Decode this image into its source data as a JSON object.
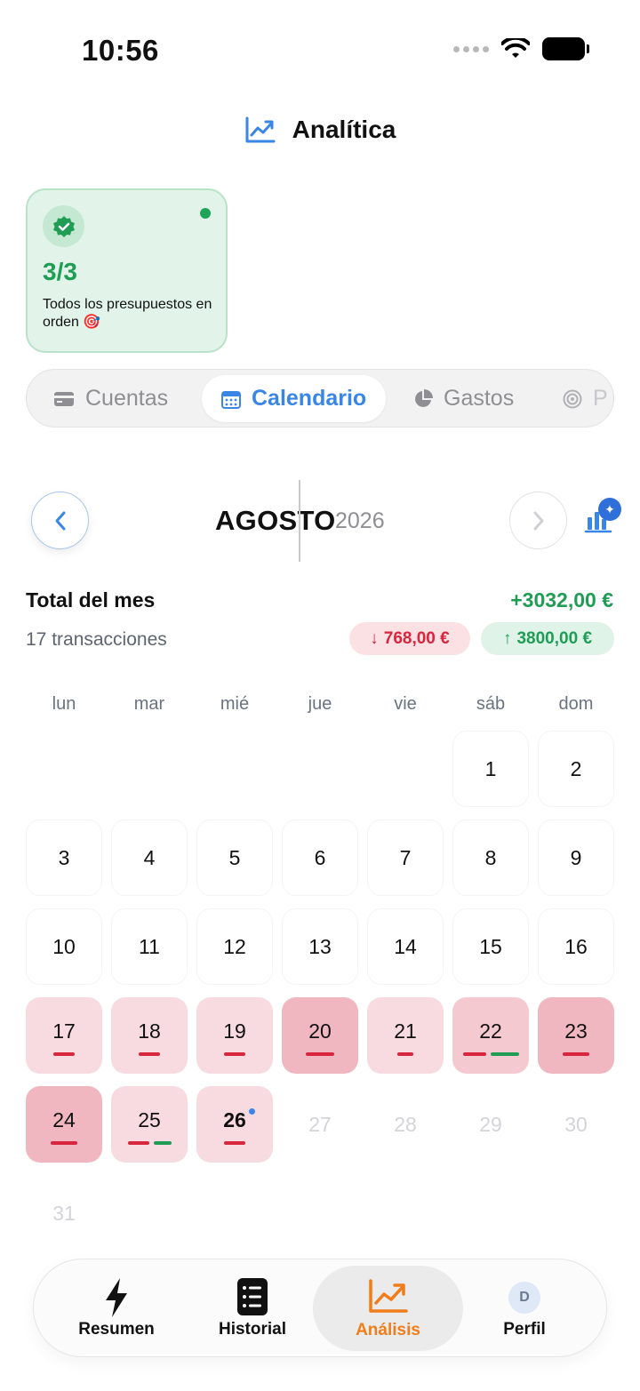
{
  "status": {
    "time": "10:56"
  },
  "header": {
    "title": "Analítica",
    "icon": "trend-chart-icon"
  },
  "budget_card": {
    "count": "3/3",
    "text": "Todos los presupuestos en orden 🎯"
  },
  "tabs": [
    {
      "label": "Cuentas",
      "icon": "card-icon",
      "active": false
    },
    {
      "label": "Calendario",
      "icon": "calendar-icon",
      "active": true
    },
    {
      "label": "Gastos",
      "icon": "pie-icon",
      "active": false
    },
    {
      "label": "P",
      "icon": "target-icon",
      "active": false
    }
  ],
  "month_nav": {
    "month": "AGOSTO",
    "year": "2026"
  },
  "totals": {
    "label": "Total del mes",
    "value": "+3032,00 €",
    "transactions": "17 transacciones",
    "expenses": "768,00 €",
    "income": "3800,00 €"
  },
  "calendar": {
    "weekdays": [
      "lun",
      "mar",
      "mié",
      "jue",
      "vie",
      "sáb",
      "dom"
    ],
    "days": [
      "1",
      "2",
      "3",
      "4",
      "5",
      "6",
      "7",
      "8",
      "9",
      "10",
      "11",
      "12",
      "13",
      "14",
      "15",
      "16",
      "17",
      "18",
      "19",
      "20",
      "21",
      "22",
      "23",
      "24",
      "25",
      "26",
      "27",
      "28",
      "29",
      "30",
      "31"
    ]
  },
  "bottom_nav": [
    {
      "label": "Resumen",
      "icon": "lightning-icon"
    },
    {
      "label": "Historial",
      "icon": "list-icon"
    },
    {
      "label": "Análisis",
      "icon": "trend-chart-icon",
      "active": true
    },
    {
      "label": "Perfil",
      "avatar_initial": "D"
    }
  ],
  "colors": {
    "accent": "#3a86e6",
    "income": "#1f9d55",
    "expense": "#d7263d",
    "active_nav": "#f07d1a"
  }
}
